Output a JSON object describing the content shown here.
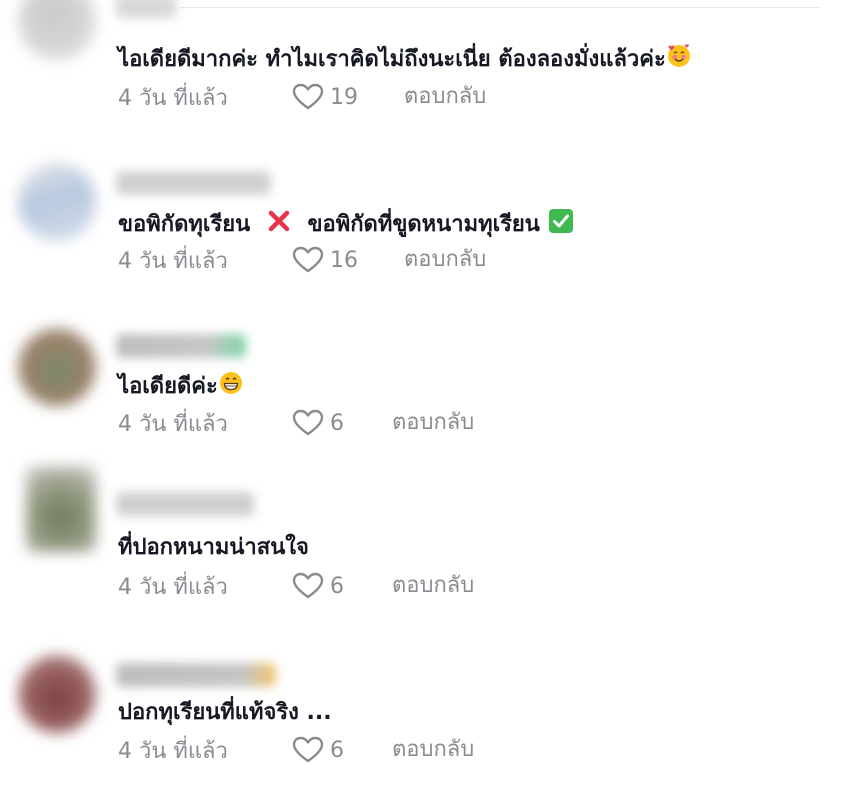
{
  "colors": {
    "text": "#161823",
    "meta": "#8a8b91",
    "background": "#ffffff"
  },
  "comments": [
    {
      "text": "ไอเดียดีมากค่ะ ทำไมเราคิดไม่ถึงนะเนี่ย ต้องลองมั่งแล้วค่ะ",
      "emoji": "smiling-face-with-hearts",
      "time": "4 วัน ที่แล้ว",
      "likes": "19",
      "reply": "ตอบกลับ"
    },
    {
      "text_part1": "ขอพิกัดทุเรียน",
      "text_part2": "ขอพิกัดที่ขูดหนามทุเรียน",
      "emoji1": "cross-mark",
      "emoji2": "check-mark-button",
      "time": "4 วัน ที่แล้ว",
      "likes": "16",
      "reply": "ตอบกลับ"
    },
    {
      "text": "ไอเดียดีค่ะ",
      "emoji": "grinning-face",
      "time": "4 วัน ที่แล้ว",
      "likes": "6",
      "reply": "ตอบกลับ"
    },
    {
      "text": "ที่ปอกหนามน่าสนใจ",
      "time": "4 วัน ที่แล้ว",
      "likes": "6",
      "reply": "ตอบกลับ"
    },
    {
      "text": "ปอกทุเรียนที่แท้จริง ...",
      "time": "4 วัน ที่แล้ว",
      "likes": "6",
      "reply": "ตอบกลับ"
    }
  ]
}
